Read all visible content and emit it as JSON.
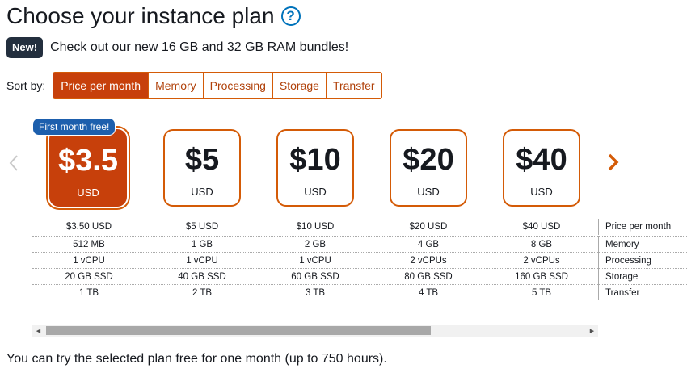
{
  "header": {
    "title": "Choose your instance plan",
    "help_icon": "?"
  },
  "promo": {
    "badge": "New!",
    "text": "Check out our new 16 GB and 32 GB RAM bundles!"
  },
  "sort": {
    "label": "Sort by:",
    "options": [
      "Price per month",
      "Memory",
      "Processing",
      "Storage",
      "Transfer"
    ],
    "selected": "Price per month"
  },
  "free_badge": "First month free!",
  "plans": [
    {
      "price": "$3.5",
      "currency": "USD",
      "price_month": "$3.50 USD",
      "memory": "512 MB",
      "processing": "1 vCPU",
      "storage": "20 GB SSD",
      "transfer": "1 TB"
    },
    {
      "price": "$5",
      "currency": "USD",
      "price_month": "$5 USD",
      "memory": "1 GB",
      "processing": "1 vCPU",
      "storage": "40 GB SSD",
      "transfer": "2 TB"
    },
    {
      "price": "$10",
      "currency": "USD",
      "price_month": "$10 USD",
      "memory": "2 GB",
      "processing": "1 vCPU",
      "storage": "60 GB SSD",
      "transfer": "3 TB"
    },
    {
      "price": "$20",
      "currency": "USD",
      "price_month": "$20 USD",
      "memory": "4 GB",
      "processing": "2 vCPUs",
      "storage": "80 GB SSD",
      "transfer": "4 TB"
    },
    {
      "price": "$40",
      "currency": "USD",
      "price_month": "$40 USD",
      "memory": "8 GB",
      "processing": "2 vCPUs",
      "storage": "160 GB SSD",
      "transfer": "5 TB"
    }
  ],
  "row_labels": [
    "Price per month",
    "Memory",
    "Processing",
    "Storage",
    "Transfer"
  ],
  "footer": "You can try the selected plan free for one month (up to 750 hours).",
  "colors": {
    "accent": "#c7400b",
    "badge_blue": "#1d5fad",
    "dark": "#232f3e"
  }
}
